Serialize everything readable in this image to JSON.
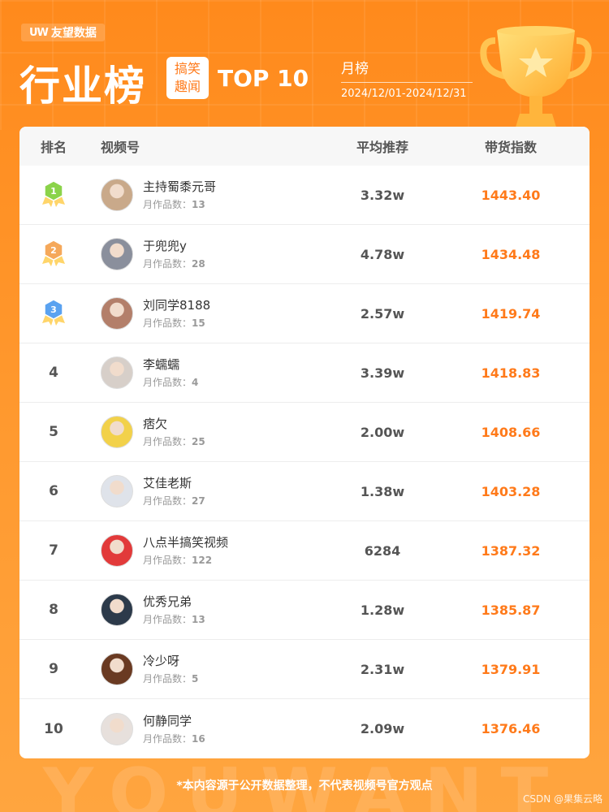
{
  "brand": {
    "icon": "UW",
    "name": "友望数据"
  },
  "title": "行业榜",
  "category": {
    "line1": "搞笑",
    "line2": "趣闻"
  },
  "top_label": "TOP 10",
  "period": {
    "type": "月榜",
    "range": "2024/12/01-2024/12/31"
  },
  "table": {
    "headers": {
      "rank": "排名",
      "account": "视频号",
      "avg": "平均推荐",
      "index": "带货指数"
    },
    "works_label": "月作品数：",
    "rows": [
      {
        "rank": "1",
        "name": "主持蜀黍元哥",
        "works": "13",
        "avg": "3.32w",
        "index": "1443.40"
      },
      {
        "rank": "2",
        "name": "于兜兜y",
        "works": "28",
        "avg": "4.78w",
        "index": "1434.48"
      },
      {
        "rank": "3",
        "name": "刘同学8188",
        "works": "15",
        "avg": "2.57w",
        "index": "1419.74"
      },
      {
        "rank": "4",
        "name": "李蠕蠕",
        "works": "4",
        "avg": "3.39w",
        "index": "1418.83"
      },
      {
        "rank": "5",
        "name": "痞欠",
        "works": "25",
        "avg": "2.00w",
        "index": "1408.66"
      },
      {
        "rank": "6",
        "name": "艾佳老斯",
        "works": "27",
        "avg": "1.38w",
        "index": "1403.28"
      },
      {
        "rank": "7",
        "name": "八点半搞笑视频",
        "works": "122",
        "avg": "6284",
        "index": "1387.32"
      },
      {
        "rank": "8",
        "name": "优秀兄弟",
        "works": "13",
        "avg": "1.28w",
        "index": "1385.87"
      },
      {
        "rank": "9",
        "name": "冷少呀",
        "works": "5",
        "avg": "2.31w",
        "index": "1379.91"
      },
      {
        "rank": "10",
        "name": "何静同学",
        "works": "16",
        "avg": "2.09w",
        "index": "1376.46"
      }
    ]
  },
  "watermark": "YOUWANT",
  "disclaimer": "*本内容源于公开数据整理，不代表视频号官方观点",
  "credit": "CSDN @果集云略",
  "colors": {
    "accent": "#ff7a1a",
    "gold": "#8bd34a",
    "silver": "#f5a85a",
    "bronze": "#5aa2f0"
  }
}
